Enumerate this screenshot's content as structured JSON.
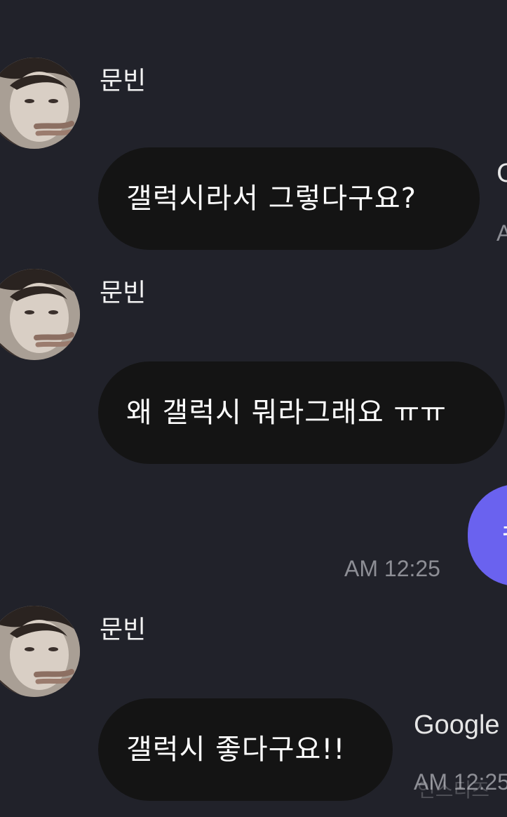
{
  "theme": {
    "background": "#21222a",
    "bubble_incoming": "#141414",
    "bubble_outgoing": "#6a62ef",
    "timestamp_color": "#8d8e95"
  },
  "messages": [
    {
      "sender": "문빈",
      "text": "갤럭시라서 그렇다구요?",
      "side_text": "G",
      "side_time": "A"
    },
    {
      "sender": "문빈",
      "text": "왜 갤럭시 뭐라그래요 ㅠㅠ"
    },
    {
      "outgoing_text": "ㅋ",
      "time": "AM 12:25"
    },
    {
      "sender": "문빈",
      "text": "갤럭시 좋다구요!!",
      "side_text": "Google",
      "side_time": "AM 12:25"
    }
  ],
  "watermark": "인스티즈",
  "icons": {
    "avatar": "profile-photo-avatar"
  }
}
